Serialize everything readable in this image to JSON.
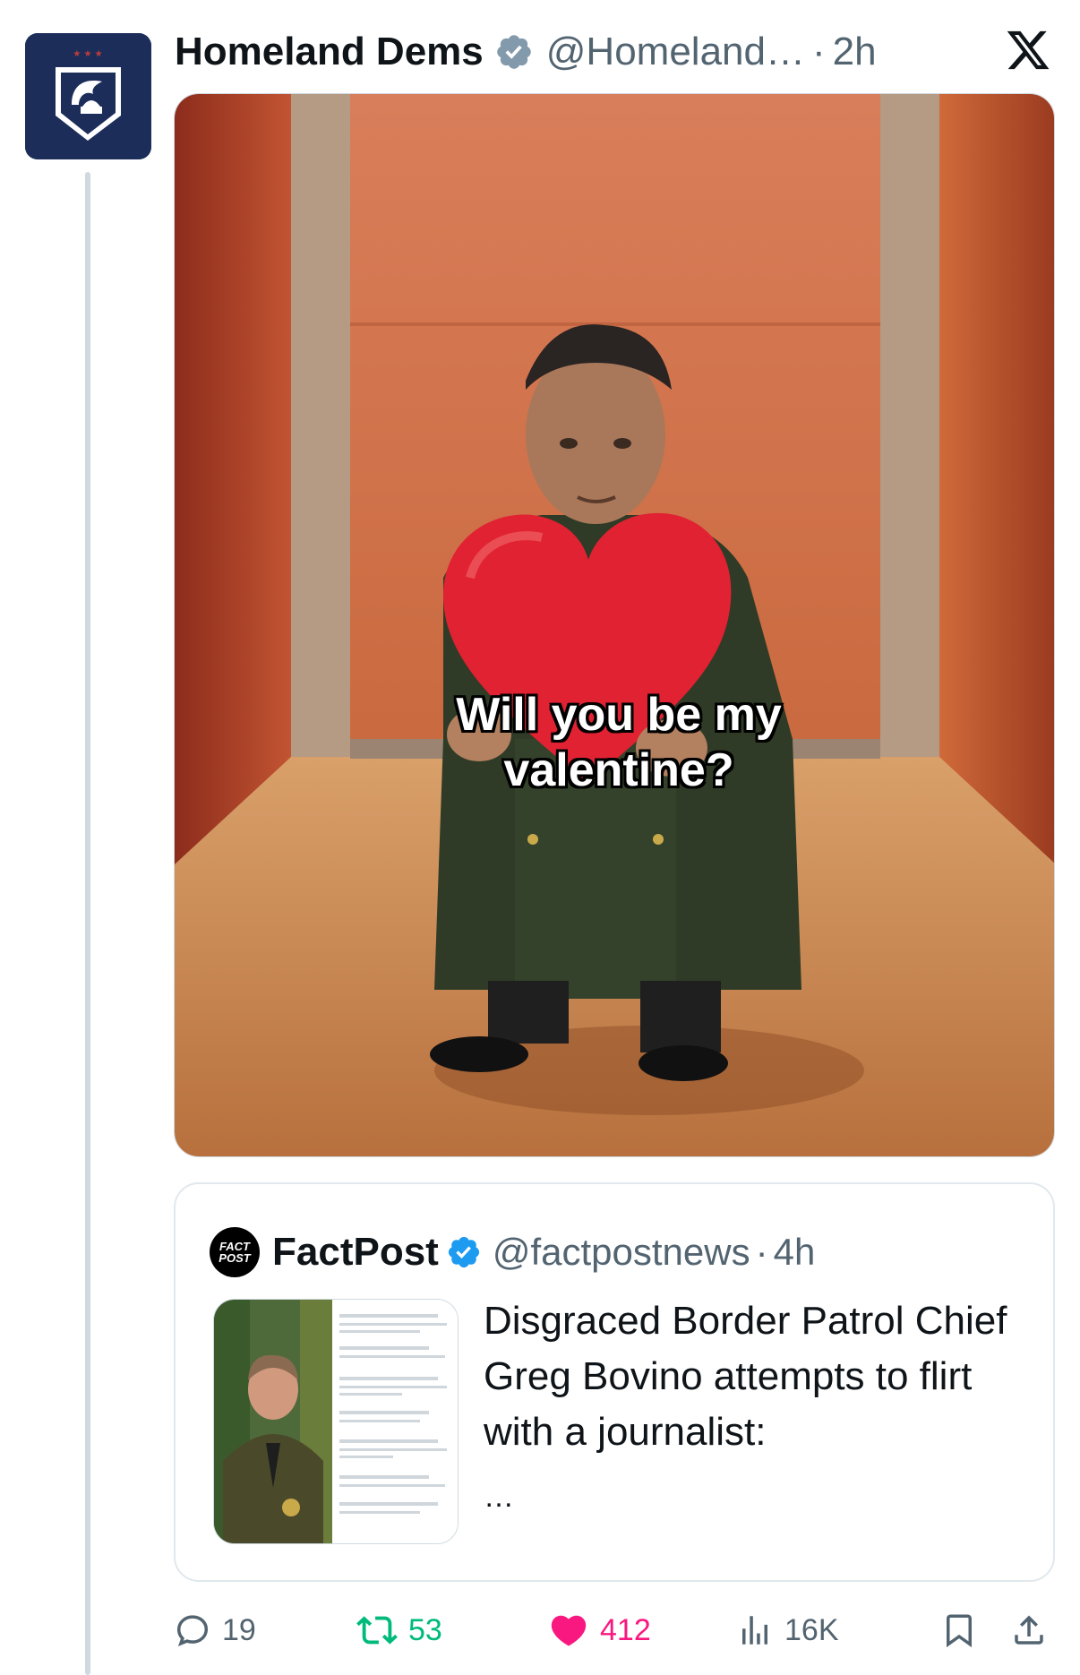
{
  "author": {
    "display_name": "Homeland Dems",
    "handle": "@Homeland…",
    "dot": "·",
    "time": "2h",
    "avatar_icon": "eagle-shield-logo",
    "verified_icon": "verified-gray-badge"
  },
  "platform_logo": "x-logo",
  "media": {
    "caption": "Will you be my valentine?",
    "description_icon": "meme-image"
  },
  "quoted": {
    "avatar_icon": "factpost-logo",
    "avatar_text_line1": "FACT",
    "avatar_text_line2": "POST",
    "display_name": "FactPost",
    "verified_icon": "verified-blue-badge",
    "handle": "@factpostnews",
    "dot": "·",
    "time": "4h",
    "text": "Disgraced Border Patrol Chief Greg Bovino attempts to flirt with a journalist:",
    "more": "…"
  },
  "actions": {
    "replies": "19",
    "reposts": "53",
    "likes": "412",
    "views": "16K",
    "reply_icon": "reply-icon",
    "repost_icon": "repost-icon",
    "like_icon": "heart-icon",
    "views_icon": "views-icon",
    "bookmark_icon": "bookmark-icon",
    "share_icon": "share-icon"
  },
  "colors": {
    "repost": "#00ba7c",
    "like": "#f91880",
    "secondary": "#536471",
    "verified_blue": "#1d9bf0",
    "verified_gray": "#829aab"
  }
}
